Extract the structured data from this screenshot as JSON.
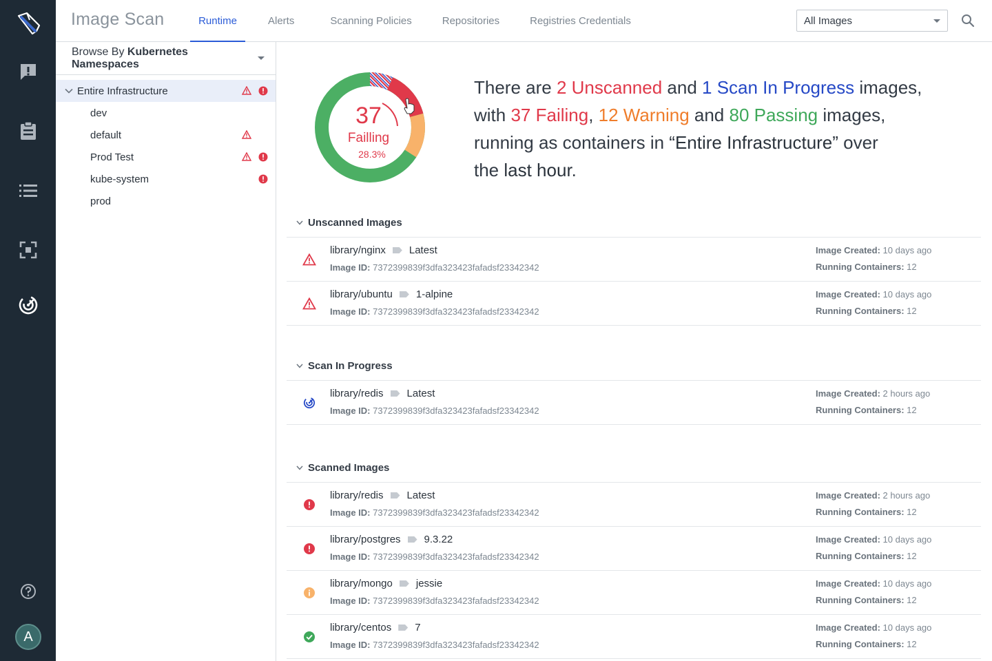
{
  "header": {
    "title": "Image Scan",
    "tabs": [
      {
        "label": "Runtime",
        "active": true
      },
      {
        "label": "Alerts",
        "active": false
      },
      {
        "label": "Scanning Policies",
        "active": false
      },
      {
        "label": "Repositories",
        "active": false
      },
      {
        "label": "Registries Credentials",
        "active": false
      }
    ],
    "image_filter": {
      "value": "All Images"
    }
  },
  "rail": {
    "icons": [
      "logo-icon",
      "alert-icon",
      "clipboard-icon",
      "list-icon",
      "scan-icon",
      "radar-icon",
      "help-icon"
    ],
    "avatar_initial": "A"
  },
  "sidebar": {
    "browse_prefix": "Browse By",
    "browse_value": "Kubernetes Namespaces",
    "root": {
      "label": "Entire Infrastructure",
      "warning": true,
      "error": true
    },
    "items": [
      {
        "label": "dev",
        "warning": false,
        "error": false
      },
      {
        "label": "default",
        "warning": true,
        "error": false
      },
      {
        "label": "Prod Test",
        "warning": true,
        "error": true
      },
      {
        "label": "kube-system",
        "warning": false,
        "error": true
      },
      {
        "label": "prod",
        "warning": false,
        "error": false
      }
    ]
  },
  "donut": {
    "number": "37",
    "label": "Failling",
    "percent": "28.3%",
    "colors": {
      "failing": "#e0394a",
      "warning": "#f8b26a",
      "passing": "#4caf64",
      "unscanned": "#e0394a",
      "in_progress": "#2649c6"
    }
  },
  "summary": {
    "p1": "There are ",
    "unscanned": "2 Unscanned",
    "p2": " and ",
    "in_progress": "1 Scan In Progress",
    "p3": " images,",
    "p4": "with ",
    "failing": "37 Failing",
    "p5": ", ",
    "warning": "12 Warning",
    "p6": " and ",
    "passing": "80 Passing",
    "p7": " images,",
    "p8": "running as containers in ",
    "scope": "“Entire Infrastructure”",
    "p9": " over",
    "p10": "the ",
    "period": "last hour",
    "p11": "."
  },
  "labels": {
    "image_id": "Image ID:",
    "image_created": "Image Created:",
    "running_containers": "Running Containers:"
  },
  "sections": {
    "unscanned": {
      "title": "Unscanned Images",
      "rows": [
        {
          "status": "warning",
          "name": "library/nginx",
          "tag": "Latest",
          "id": "7372399839f3dfa323423fafadsf23342342",
          "created": "10 days ago",
          "running": "12"
        },
        {
          "status": "warning",
          "name": "library/ubuntu",
          "tag": "1-alpine",
          "id": "7372399839f3dfa323423fafadsf23342342",
          "created": "10 days ago",
          "running": "12"
        }
      ]
    },
    "in_progress": {
      "title": "Scan In Progress",
      "rows": [
        {
          "status": "scanning",
          "name": "library/redis",
          "tag": "Latest",
          "id": "7372399839f3dfa323423fafadsf23342342",
          "created": " 2 hours ago",
          "running": "12"
        }
      ]
    },
    "scanned": {
      "title": "Scanned Images",
      "rows": [
        {
          "status": "failing",
          "name": "library/redis",
          "tag": "Latest",
          "id": "7372399839f3dfa323423fafadsf23342342",
          "created": " 2 hours ago",
          "running": "12"
        },
        {
          "status": "failing",
          "name": "library/postgres",
          "tag": "9.3.22",
          "id": "7372399839f3dfa323423fafadsf23342342",
          "created": "10 days ago",
          "running": "12"
        },
        {
          "status": "warn-info",
          "name": "library/mongo",
          "tag": "jessie",
          "id": "7372399839f3dfa323423fafadsf23342342",
          "created": "10 days ago",
          "running": "12"
        },
        {
          "status": "passing",
          "name": "library/centos",
          "tag": "7",
          "id": "7372399839f3dfa323423fafadsf23342342",
          "created": "10 days ago",
          "running": "12"
        }
      ]
    }
  }
}
